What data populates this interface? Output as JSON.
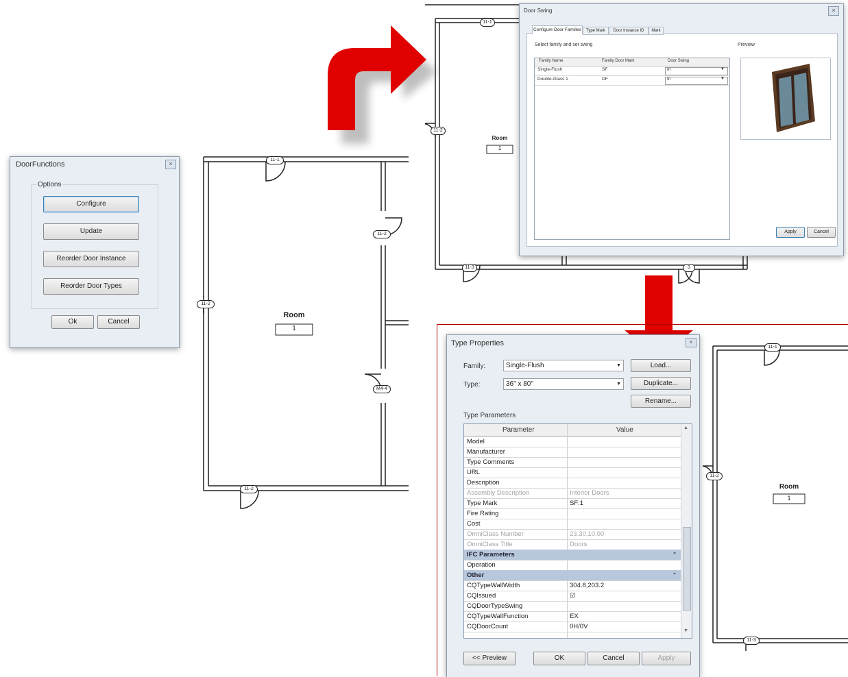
{
  "door_functions": {
    "title": "DoorFunctions",
    "close": "×",
    "group_label": "Options",
    "buttons": [
      "Configure",
      "Update",
      "Reorder Door Instance",
      "Reorder Door Types"
    ],
    "ok": "Ok",
    "cancel": "Cancel"
  },
  "plan_main": {
    "room_label": "Room",
    "room_number": "1",
    "tags": [
      "11-1",
      "11-2",
      "11-2",
      "M4-4",
      "11-2"
    ]
  },
  "door_swing": {
    "title": "Door Swing",
    "close": "×",
    "tabs": [
      "Configure Door Families",
      "Type Mark",
      "Door Instance ID",
      "Mark"
    ],
    "instruction": "Select family and set swing",
    "preview_label": "Preview",
    "columns": [
      "Family Name",
      "Family Door Mark",
      "Door Swing"
    ],
    "rows": [
      {
        "family": "Single-Flush",
        "mark": "SF",
        "swing": "In"
      },
      {
        "family": "Double-Glass 1",
        "mark": "DF",
        "swing": "In"
      }
    ],
    "apply": "Apply",
    "cancel": "Cancel",
    "bg_plan": {
      "room_label": "Room",
      "room_number": "1",
      "tags": [
        "11-1",
        "11-2",
        "11-3",
        "3"
      ]
    }
  },
  "type_properties": {
    "title": "Type Properties",
    "close": "×",
    "family_label": "Family:",
    "family_value": "Single-Flush",
    "type_label": "Type:",
    "type_value": "36\" x 80\"",
    "load": "Load...",
    "duplicate": "Duplicate...",
    "rename": "Rename...",
    "section_label": "Type Parameters",
    "col_parameter": "Parameter",
    "col_value": "Value",
    "rows": [
      {
        "p": "Model",
        "v": "",
        "kind": "normal"
      },
      {
        "p": "Manufacturer",
        "v": "",
        "kind": "normal"
      },
      {
        "p": "Type Comments",
        "v": "",
        "kind": "normal"
      },
      {
        "p": "URL",
        "v": "",
        "kind": "normal"
      },
      {
        "p": "Description",
        "v": "",
        "kind": "normal"
      },
      {
        "p": "Assembly Description",
        "v": "Interior Doors",
        "kind": "dim"
      },
      {
        "p": "Type Mark",
        "v": "SF:1",
        "kind": "normal"
      },
      {
        "p": "Fire Rating",
        "v": "",
        "kind": "normal"
      },
      {
        "p": "Cost",
        "v": "",
        "kind": "normal"
      },
      {
        "p": "OmniClass Number",
        "v": "23.30.10.00",
        "kind": "dim"
      },
      {
        "p": "OmniClass Title",
        "v": "Doors",
        "kind": "dim"
      },
      {
        "p": "IFC Parameters",
        "v": "",
        "kind": "header"
      },
      {
        "p": "Operation",
        "v": "",
        "kind": "normal"
      },
      {
        "p": "Other",
        "v": "",
        "kind": "header"
      },
      {
        "p": "CQTypeWallWidth",
        "v": "304.8,203.2",
        "kind": "normal"
      },
      {
        "p": "CQIssued",
        "v": "☑",
        "kind": "normal"
      },
      {
        "p": "CQDoorTypeSwing",
        "v": "",
        "kind": "normal"
      },
      {
        "p": "CQTypeWallFunction",
        "v": "EX",
        "kind": "normal"
      },
      {
        "p": "CQDoorCount",
        "v": "0H/0V",
        "kind": "normal"
      }
    ],
    "preview": "<< Preview",
    "ok": "OK",
    "cancel": "Cancel",
    "apply": "Apply",
    "bg_plan": {
      "room_label": "Room",
      "room_number": "1",
      "tags": [
        "11-1",
        "11-2",
        "11-3"
      ]
    }
  },
  "colors": {
    "arrow": "#e00000",
    "dialog_bg": "#e9eef4",
    "header_row": "#b8c8dc",
    "frame_red": "#b00000"
  }
}
